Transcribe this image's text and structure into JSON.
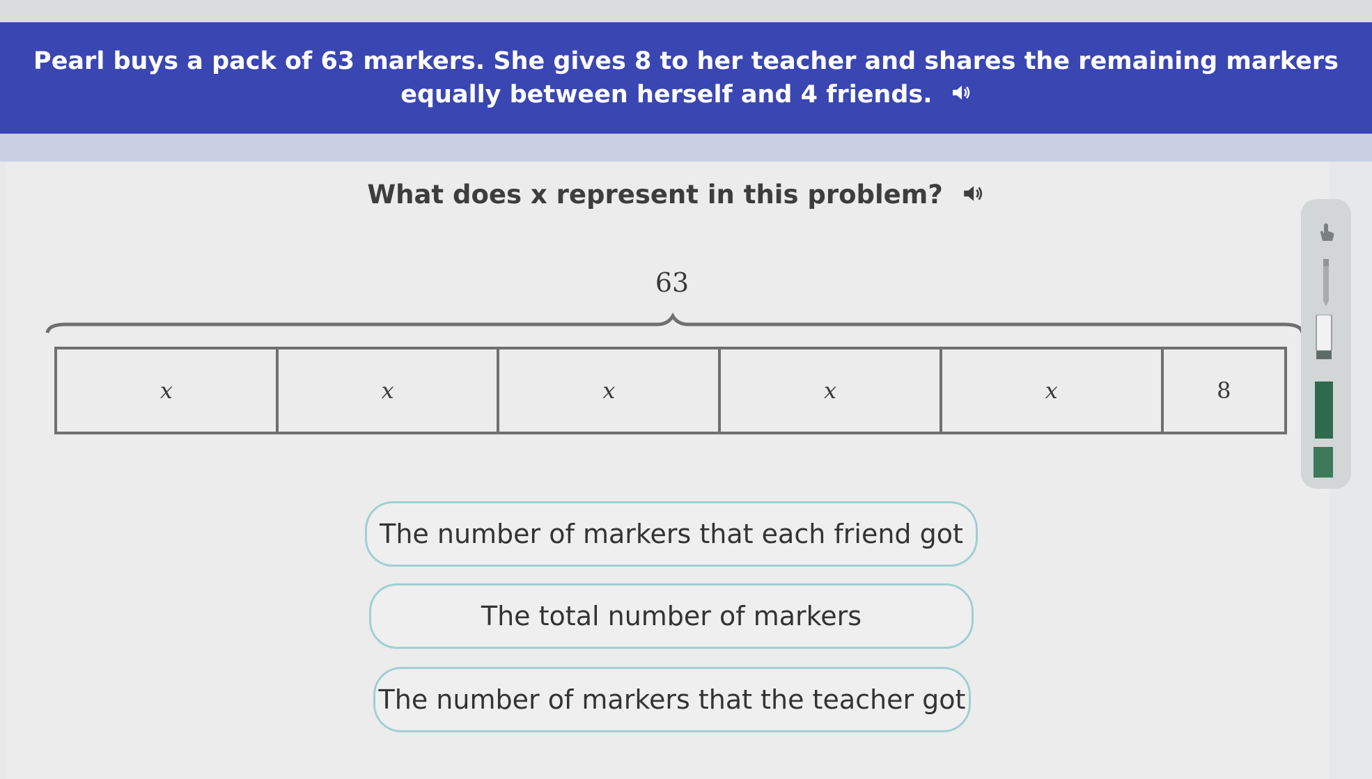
{
  "problem": {
    "line1": "Pearl buys a pack of 63 markers. She gives 8 to her teacher and shares the remaining markers",
    "line2": "equally between herself and 4 friends.",
    "audio_icon": "speaker-icon"
  },
  "question": {
    "text": "What does x represent in this problem?",
    "audio_icon": "speaker-icon"
  },
  "tape_diagram": {
    "total": "63",
    "cells": [
      "x",
      "x",
      "x",
      "x",
      "x",
      "8"
    ]
  },
  "answers": [
    "The number of markers that each friend got",
    "The total number of markers",
    "The number of markers that the teacher got"
  ],
  "tools": [
    "hand-pointer-icon",
    "pencil-icon",
    "eraser-icon",
    "highlighter-icon"
  ],
  "colors": {
    "banner": "#3a46b2",
    "choice_border": "#9fcfd2",
    "tool_green": "#2e6b4e"
  }
}
